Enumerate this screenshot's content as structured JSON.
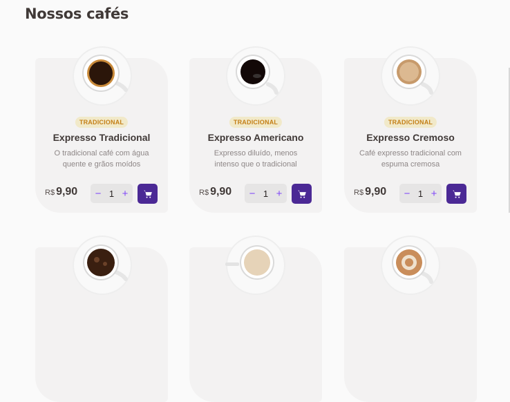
{
  "page": {
    "title": "Nossos cafés"
  },
  "currency": "R$",
  "cart_icon": "shopping-cart-icon",
  "colors": {
    "accent": "#4b2995",
    "purple": "#8047f8",
    "tag_bg": "#f1e9c9",
    "tag_text": "#c47f17",
    "card_bg": "#f3f2f2"
  },
  "products": [
    {
      "tag": "TRADICIONAL",
      "name": "Expresso Tradicional",
      "desc": "O tradicional café com água quente e grãos moídos",
      "price": "9,90",
      "qty": "1",
      "minus": "−",
      "plus": "+"
    },
    {
      "tag": "TRADICIONAL",
      "name": "Expresso Americano",
      "desc": "Expresso diluído, menos intenso que o tradicional",
      "price": "9,90",
      "qty": "1",
      "minus": "−",
      "plus": "+"
    },
    {
      "tag": "TRADICIONAL",
      "name": "Expresso Cremoso",
      "desc": "Café expresso tradicional com espuma cremosa",
      "price": "9,90",
      "qty": "1",
      "minus": "−",
      "plus": "+"
    }
  ]
}
